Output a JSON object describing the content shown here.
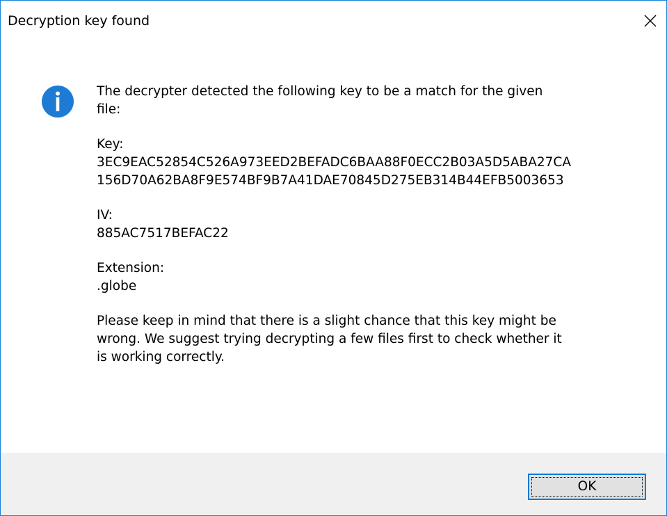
{
  "window": {
    "title": "Decryption key found",
    "close_label": "Close"
  },
  "icon": {
    "name": "info-icon",
    "color": "#1e7bd3"
  },
  "message": {
    "intro_line1": "The decrypter detected the following key to be a match for the given",
    "intro_line2": "file:",
    "key_label": "Key:",
    "key_line1": "3EC9EAC52854C526A973EED2BEFADC6BAA88F0ECC2B03A5D5ABA27CA",
    "key_line2": "156D70A62BA8F9E574BF9B7A41DAE70845D275EB314B44EFB5003653",
    "iv_label": "IV:",
    "iv_value": "885AC7517BEFAC22",
    "extension_label": "Extension:",
    "extension_value": ".globe",
    "warning_line1": "Please keep in mind that there is a slight chance that this key might be",
    "warning_line2": "wrong. We suggest trying decrypting a few files first to check whether it",
    "warning_line3": "is working correctly."
  },
  "buttons": {
    "ok_label": "OK"
  },
  "colors": {
    "accent": "#0078d7",
    "window_border": "#1883d7",
    "footer_bg": "#f0f0f0",
    "button_bg": "#e1e1e1"
  }
}
